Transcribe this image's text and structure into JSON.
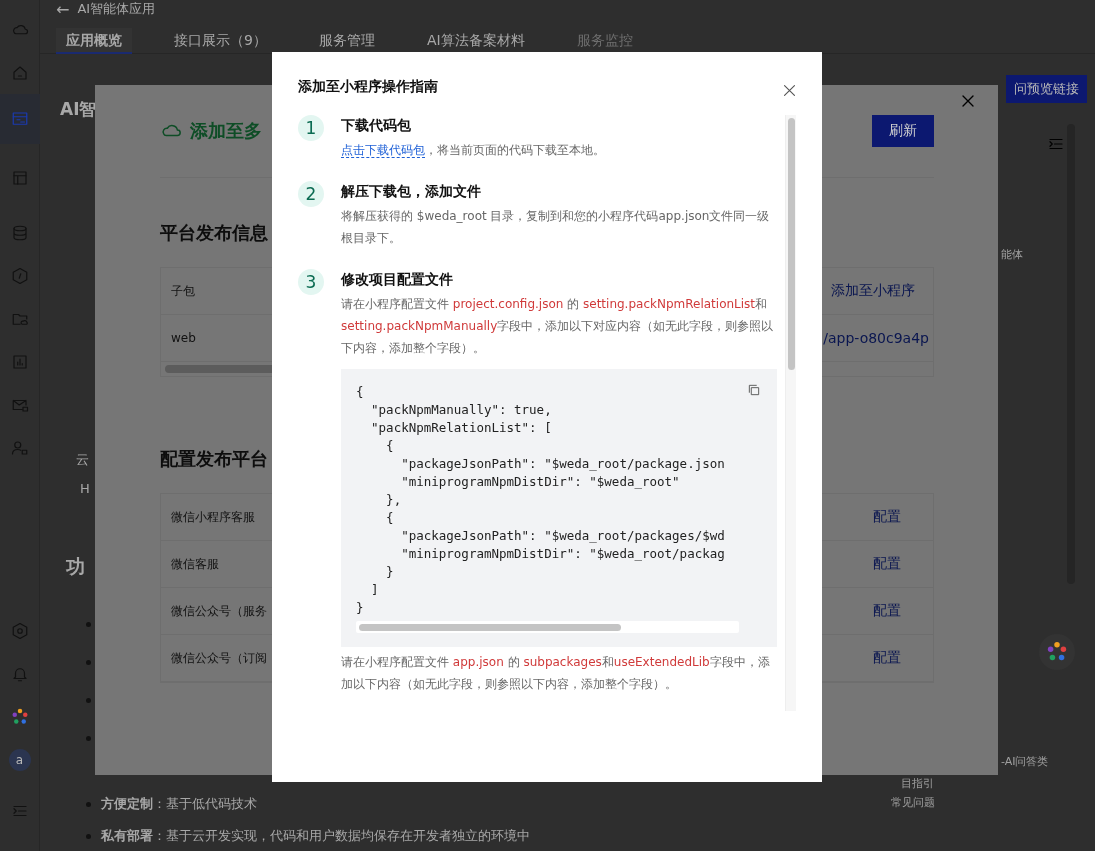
{
  "page": {
    "back_label": "←",
    "title": "AI智能体应用",
    "tabs": [
      {
        "label": "应用概览",
        "selected": true,
        "disabled": false
      },
      {
        "label": "接口展示（9）",
        "selected": false,
        "disabled": false
      },
      {
        "label": "服务管理",
        "selected": false,
        "disabled": false
      },
      {
        "label": "AI算法备案材料",
        "selected": false,
        "disabled": false
      },
      {
        "label": "服务监控",
        "selected": false,
        "disabled": true
      }
    ],
    "heading": "AI智",
    "intro_lines": [
      "云",
      "H"
    ],
    "section_heading": "功",
    "bullets": [
      {
        "bold": "方便定制",
        "text": "：基于低代码技术"
      },
      {
        "bold": "私有部署",
        "text": "：基于云开发实现，代码和用户数据均保存在开发者独立的环境中"
      }
    ],
    "preview_button": "问预览链接",
    "side_texts": [
      "能体",
      "-AI问答类",
      "目指引",
      "常见问题"
    ],
    "avatar_letter": "a"
  },
  "drawer": {
    "banner": "添加至多",
    "refresh_button": "刷新",
    "publish_heading": "平台发布信息",
    "publish_rows": [
      {
        "name": "子包",
        "action": "添加至小程序"
      },
      {
        "name": "web",
        "action": "/app-o80c9a4p"
      }
    ],
    "config_heading": "配置发布平台",
    "config_rows": [
      {
        "name": "微信小程序客服",
        "action": "配置"
      },
      {
        "name": "微信客服",
        "action": "配置"
      },
      {
        "name": "微信公众号（服务",
        "action": "配置"
      },
      {
        "name": "微信公众号（订阅",
        "action": "配置"
      }
    ]
  },
  "dialog": {
    "title": "添加至小程序操作指南",
    "steps": [
      {
        "number": "1",
        "title": "下载代码包",
        "body": [
          {
            "kind": "link",
            "text": "点击下载代码包"
          },
          {
            "kind": "plain",
            "text": "，将当前页面的代码下载至本地。"
          }
        ]
      },
      {
        "number": "2",
        "title": "解压下载包，添加文件",
        "body": [
          {
            "kind": "plain",
            "text": "将解压获得的 $weda_root 目录，复制到和您的小程序代码app.json文件同一级根目录下。"
          }
        ]
      },
      {
        "number": "3",
        "title": "修改项目配置文件",
        "body": [
          {
            "kind": "plain",
            "text": "请在小程序配置文件 "
          },
          {
            "kind": "code",
            "text": "project.config.json"
          },
          {
            "kind": "plain",
            "text": " 的 "
          },
          {
            "kind": "code",
            "text": "setting.packNpmRelationList"
          },
          {
            "kind": "plain",
            "text": "和"
          },
          {
            "kind": "code",
            "text": "setting.packNpmManually"
          },
          {
            "kind": "plain",
            "text": "字段中，添加以下对应内容（如无此字段，则参照以下内容，添加整个字段）。"
          }
        ],
        "code": [
          "{",
          "  \"packNpmManually\": true,",
          "  \"packNpmRelationList\": [",
          "    {",
          "      \"packageJsonPath\": \"$weda_root/package.json",
          "      \"miniprogramNpmDistDir\": \"$weda_root\"",
          "    },",
          "    {",
          "      \"packageJsonPath\": \"$weda_root/packages/$wd",
          "      \"miniprogramNpmDistDir\": \"$weda_root/packag",
          "    }",
          "  ]",
          "}"
        ],
        "after": [
          {
            "kind": "plain",
            "text": "请在小程序配置文件 "
          },
          {
            "kind": "code",
            "text": "app.json"
          },
          {
            "kind": "plain",
            "text": " 的 "
          },
          {
            "kind": "code",
            "text": "subpackages"
          },
          {
            "kind": "plain",
            "text": "和"
          },
          {
            "kind": "code",
            "text": "useExtendedLib"
          },
          {
            "kind": "plain",
            "text": "字段中，添加以下内容（如无此字段，则参照以下内容，添加整个字段）。"
          }
        ]
      }
    ]
  }
}
